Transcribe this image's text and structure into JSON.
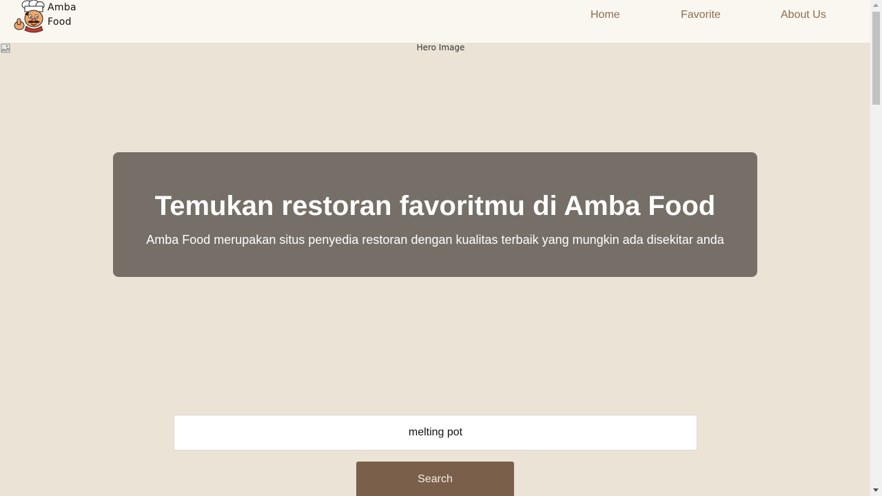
{
  "header": {
    "brand_name": "Amba Food",
    "logo_icon": "chef-mascot-icon",
    "nav": [
      {
        "label": "Home"
      },
      {
        "label": "Favorite"
      },
      {
        "label": "About Us"
      }
    ]
  },
  "hero": {
    "image_alt": "Hero Image",
    "title": "Temukan restoran favoritmu di Amba Food",
    "subtitle": "Amba Food merupakan situs penyedia restoran dengan kualitas terbaik yang mungkin ada disekitar anda"
  },
  "search": {
    "value": "melting pot",
    "button_label": "Search"
  },
  "colors": {
    "page_background": "#ebe4d6",
    "header_background": "#faf7f0",
    "nav_link": "#8b6d4f",
    "hero_card": "#756f67",
    "button": "#7a604a"
  }
}
